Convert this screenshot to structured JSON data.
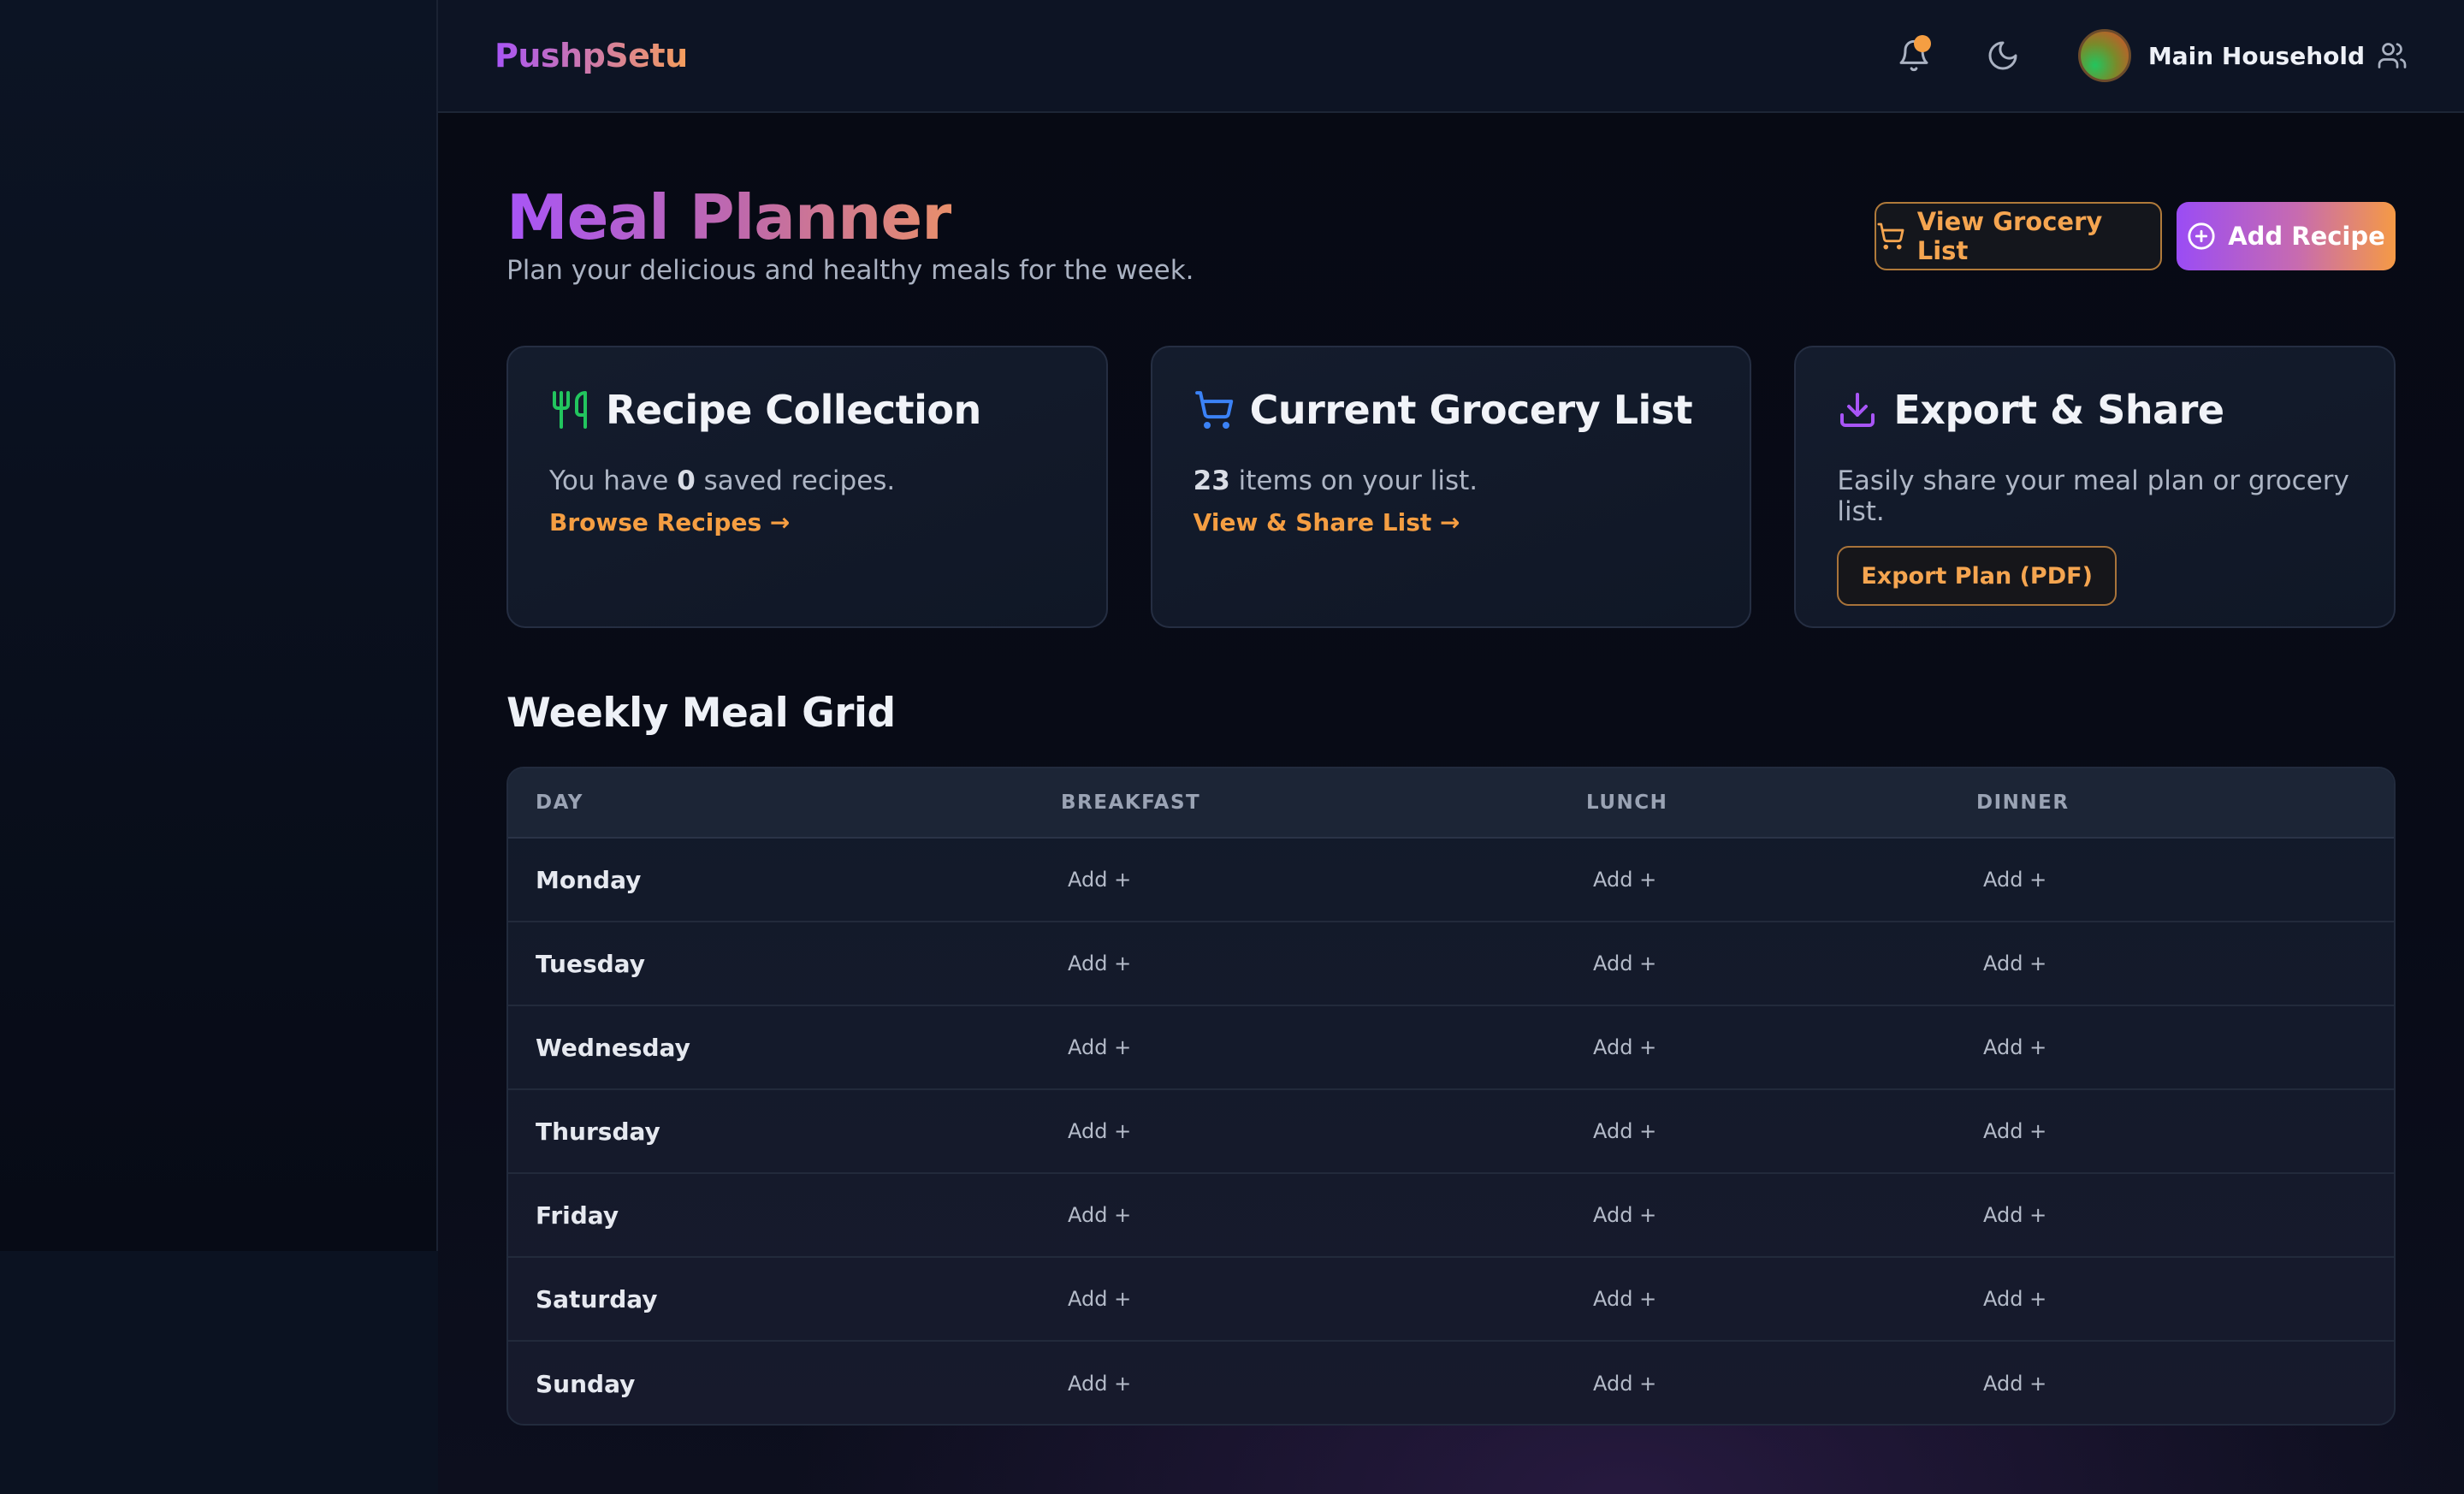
{
  "app": {
    "brand": "PushpSetu",
    "household_name": "Main Household"
  },
  "header": {
    "title": "Meal Planner",
    "subtitle": "Plan your delicious and healthy meals for the week.",
    "grocery_button": "View Grocery List",
    "add_recipe_button": "Add Recipe"
  },
  "cards": {
    "recipes": {
      "title": "Recipe Collection",
      "text_prefix": "You have ",
      "count": "0",
      "text_suffix": " saved recipes.",
      "link": "Browse Recipes →"
    },
    "grocery": {
      "title": "Current Grocery List",
      "count": "23",
      "text_suffix": " items on your list.",
      "link": "View & Share List →"
    },
    "export": {
      "title": "Export & Share",
      "text": "Easily share your meal plan or grocery list.",
      "button": "Export Plan (PDF)"
    }
  },
  "grid": {
    "title": "Weekly Meal Grid",
    "columns": [
      "DAY",
      "BREAKFAST",
      "LUNCH",
      "DINNER"
    ],
    "add_label": "Add +",
    "days": [
      "Monday",
      "Tuesday",
      "Wednesday",
      "Thursday",
      "Friday",
      "Saturday",
      "Sunday"
    ]
  },
  "colors": {
    "accent_orange": "#f59e42",
    "accent_purple": "#a855f7",
    "recipe_icon": "#22c55e",
    "grocery_icon": "#3b82f6",
    "export_icon": "#a855f7"
  },
  "icons": {
    "notification": "bell-icon",
    "theme": "moon-icon",
    "household": "users-icon",
    "grocery_button": "cart-icon",
    "add_recipe": "plus-circle-icon",
    "recipe_card": "utensils-icon",
    "grocery_card": "cart-icon",
    "export_card": "download-icon"
  }
}
